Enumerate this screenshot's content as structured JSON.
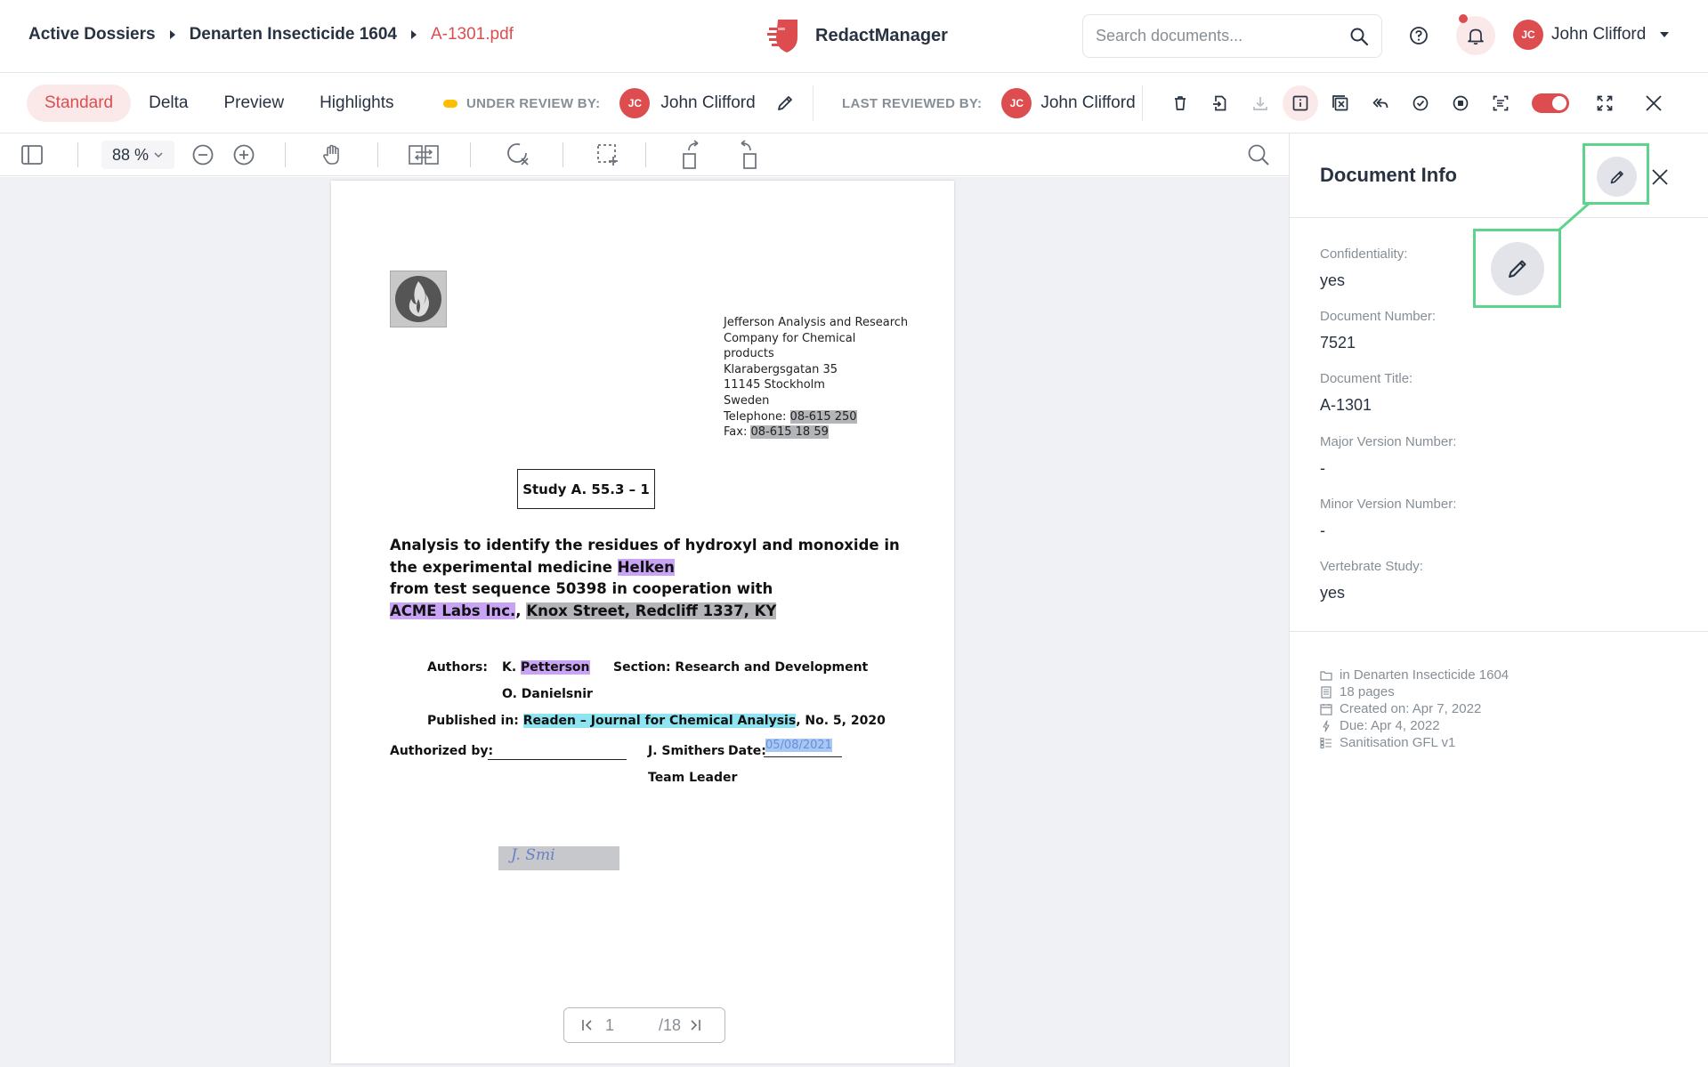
{
  "breadcrumb": {
    "items": [
      "Active Dossiers",
      "Denarten Insecticide 1604"
    ],
    "current": "A-1301.pdf"
  },
  "brand": {
    "name": "RedactManager",
    "icon": "redactmanager-logo"
  },
  "search": {
    "placeholder": "Search documents..."
  },
  "user": {
    "initials": "JC",
    "name": "John Clifford"
  },
  "view_tabs": [
    "Standard",
    "Delta",
    "Preview",
    "Highlights"
  ],
  "active_tab": "Standard",
  "review": {
    "under_review_label": "UNDER REVIEW BY:",
    "under_review_initials": "JC",
    "under_review_name": "John Clifford",
    "last_reviewed_label": "LAST REVIEWED BY:",
    "last_reviewed_initials": "JC",
    "last_reviewed_name": "John Clifford"
  },
  "viewer": {
    "zoom": "88 %",
    "page": "1",
    "total_pages": "/18"
  },
  "document": {
    "address": [
      "Jefferson Analysis and Research",
      "Company for Chemical",
      "products",
      "Klarabergsgatan 35",
      "11145 Stockholm",
      "Sweden"
    ],
    "telephone_label": "Telephone: ",
    "telephone": "08-615 250",
    "fax_label": "Fax: ",
    "fax": "08-615 18 59",
    "study": "Study A. 55.3 – 1",
    "title_line1": "Analysis to identify the residues of hydroxyl and monoxide in",
    "title_line2_a": "the experimental medicine ",
    "title_line2_b": "Helken",
    "title_line3": "from test sequence 50398 in cooperation with",
    "title_line4_a": "ACME Labs Inc.",
    "title_line4_b": ", ",
    "title_line4_c": "Knox Street, Redcliff 1337, KY",
    "authors_label": "Authors:",
    "author1_a": "K. ",
    "author1_b": "Petterson",
    "section": "Section: Research and Development",
    "author2": "O. Danielsnir",
    "published_label": "Published in: ",
    "published_journal": "Readen – Journal for Chemical Analysis",
    "published_rest": ", No. 5, 2020",
    "authorized_label": "Authorized by:",
    "signature": "J. Smi",
    "signer": "J. Smithers",
    "date_label": "Date:",
    "date": "05/08/2021",
    "role": "Team Leader"
  },
  "document_info": {
    "title": "Document Info",
    "fields": [
      {
        "label": "Confidentiality:",
        "value": "yes"
      },
      {
        "label": "Document Number:",
        "value": "7521"
      },
      {
        "label": "Document Title:",
        "value": "A-1301"
      },
      {
        "label": "Major Version Number:",
        "value": "-"
      },
      {
        "label": "Minor Version Number:",
        "value": "-"
      },
      {
        "label": "Vertebrate Study:",
        "value": "yes"
      }
    ],
    "meta": [
      {
        "icon": "folder-icon",
        "text": "in Denarten Insecticide 1604"
      },
      {
        "icon": "pages-icon",
        "text": "18 pages"
      },
      {
        "icon": "calendar-icon",
        "text": "Created on: Apr 7, 2022"
      },
      {
        "icon": "lightning-icon",
        "text": "Due: Apr 4, 2022"
      },
      {
        "icon": "template-icon",
        "text": "Sanitisation GFL v1"
      }
    ]
  },
  "colors": {
    "accent": "#dd4d50",
    "highlight_callout": "#5dd48c",
    "review_status": "#fdbd00",
    "redaction_gray": "#b3b5b9",
    "redaction_purple": "#c9a4f5",
    "redaction_cyan": "#8fe4f1"
  }
}
